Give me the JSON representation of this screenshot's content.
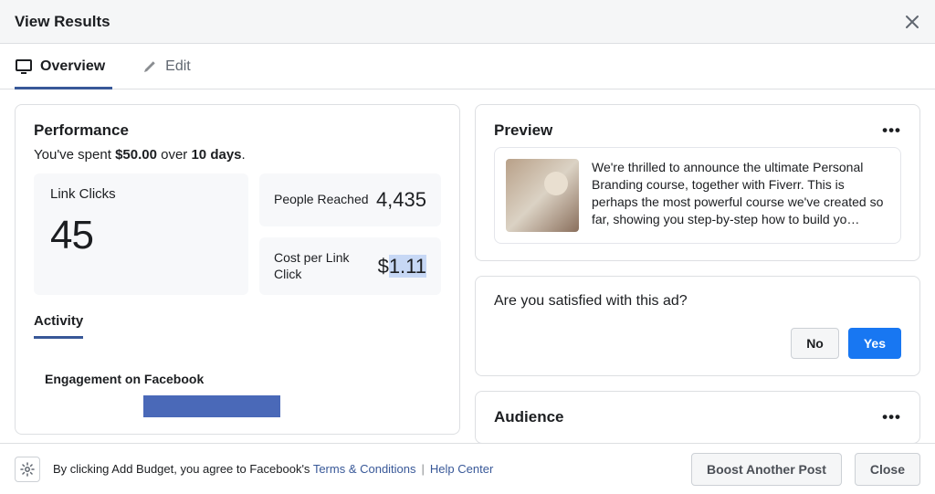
{
  "header": {
    "title": "View Results"
  },
  "tabs": {
    "overview": "Overview",
    "edit": "Edit"
  },
  "performance": {
    "title": "Performance",
    "spent_prefix": "You've spent ",
    "spent_amount": "$50.00",
    "spent_mid": " over ",
    "spent_days": "10 days",
    "spent_suffix": ".",
    "link_clicks_label": "Link Clicks",
    "link_clicks_value": "45",
    "people_reached_label": "People Reached",
    "people_reached_value": "4,435",
    "cost_per_click_label": "Cost per Link Click",
    "cost_per_click_currency": "$",
    "cost_per_click_value": "1.11",
    "subtab_activity": "Activity",
    "engagement_title": "Engagement on Facebook"
  },
  "preview": {
    "title": "Preview",
    "text": "We're thrilled to announce the ultimate Personal Branding course, together with Fiverr. This is perhaps the most powerful course we've created so far, showing you step-by-step how to build yo…"
  },
  "satisfaction": {
    "question": "Are you satisfied with this ad?",
    "no": "No",
    "yes": "Yes"
  },
  "audience": {
    "title": "Audience"
  },
  "footer": {
    "text_prefix": "By clicking Add Budget, you agree to Facebook's ",
    "terms": "Terms & Conditions",
    "help": "Help Center",
    "boost": "Boost Another Post",
    "close": "Close"
  }
}
